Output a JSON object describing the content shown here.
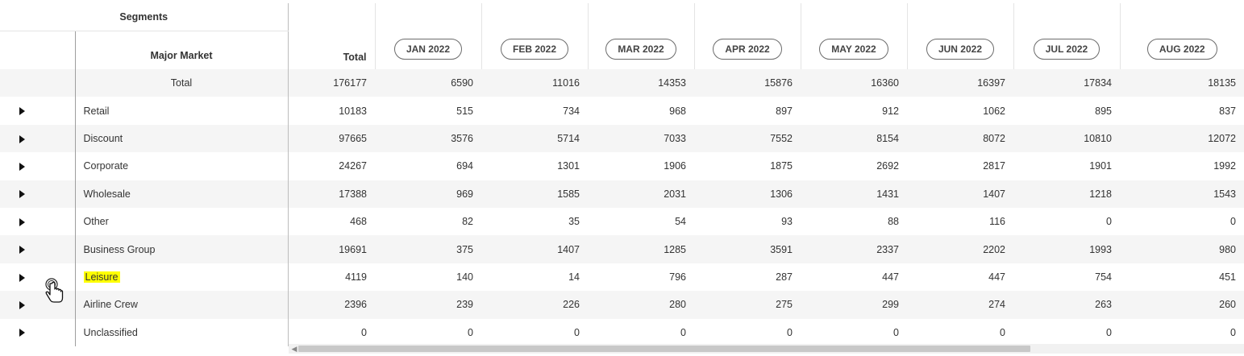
{
  "headers": {
    "segments": "Segments",
    "major_market": "Major Market",
    "total": "Total",
    "months": [
      "JAN 2022",
      "FEB 2022",
      "MAR 2022",
      "APR 2022",
      "MAY 2022",
      "JUN 2022",
      "JUL 2022",
      "AUG 2022"
    ]
  },
  "total_row": {
    "label": "Total",
    "total": "176177",
    "values": [
      "6590",
      "11016",
      "14353",
      "15876",
      "16360",
      "16397",
      "17834",
      "18135"
    ]
  },
  "rows": [
    {
      "label": "Retail",
      "total": "10183",
      "values": [
        "515",
        "734",
        "968",
        "897",
        "912",
        "1062",
        "895",
        "837"
      ]
    },
    {
      "label": "Discount",
      "total": "97665",
      "values": [
        "3576",
        "5714",
        "7033",
        "7552",
        "8154",
        "8072",
        "10810",
        "12072"
      ]
    },
    {
      "label": "Corporate",
      "total": "24267",
      "values": [
        "694",
        "1301",
        "1906",
        "1875",
        "2692",
        "2817",
        "1901",
        "1992"
      ]
    },
    {
      "label": "Wholesale",
      "total": "17388",
      "values": [
        "969",
        "1585",
        "2031",
        "1306",
        "1431",
        "1407",
        "1218",
        "1543"
      ]
    },
    {
      "label": "Other",
      "total": "468",
      "values": [
        "82",
        "35",
        "54",
        "93",
        "88",
        "116",
        "0",
        "0"
      ]
    },
    {
      "label": "Business Group",
      "total": "19691",
      "values": [
        "375",
        "1407",
        "1285",
        "3591",
        "2337",
        "2202",
        "1993",
        "980"
      ]
    },
    {
      "label": "Leisure",
      "total": "4119",
      "values": [
        "140",
        "14",
        "796",
        "287",
        "447",
        "447",
        "754",
        "451"
      ],
      "highlighted": true
    },
    {
      "label": "Airline Crew",
      "total": "2396",
      "values": [
        "239",
        "226",
        "280",
        "275",
        "299",
        "274",
        "263",
        "260"
      ]
    },
    {
      "label": "Unclassified",
      "total": "0",
      "values": [
        "0",
        "0",
        "0",
        "0",
        "0",
        "0",
        "0",
        "0"
      ]
    }
  ],
  "icons": {
    "expand": "caret-right-icon",
    "cursor": "hand-pointer-icon",
    "scroll_left": "chevron-left-icon"
  },
  "colors": {
    "highlight": "#ffff00",
    "row_shade": "#f5f5f5",
    "pill_border": "#6b6b6b"
  }
}
